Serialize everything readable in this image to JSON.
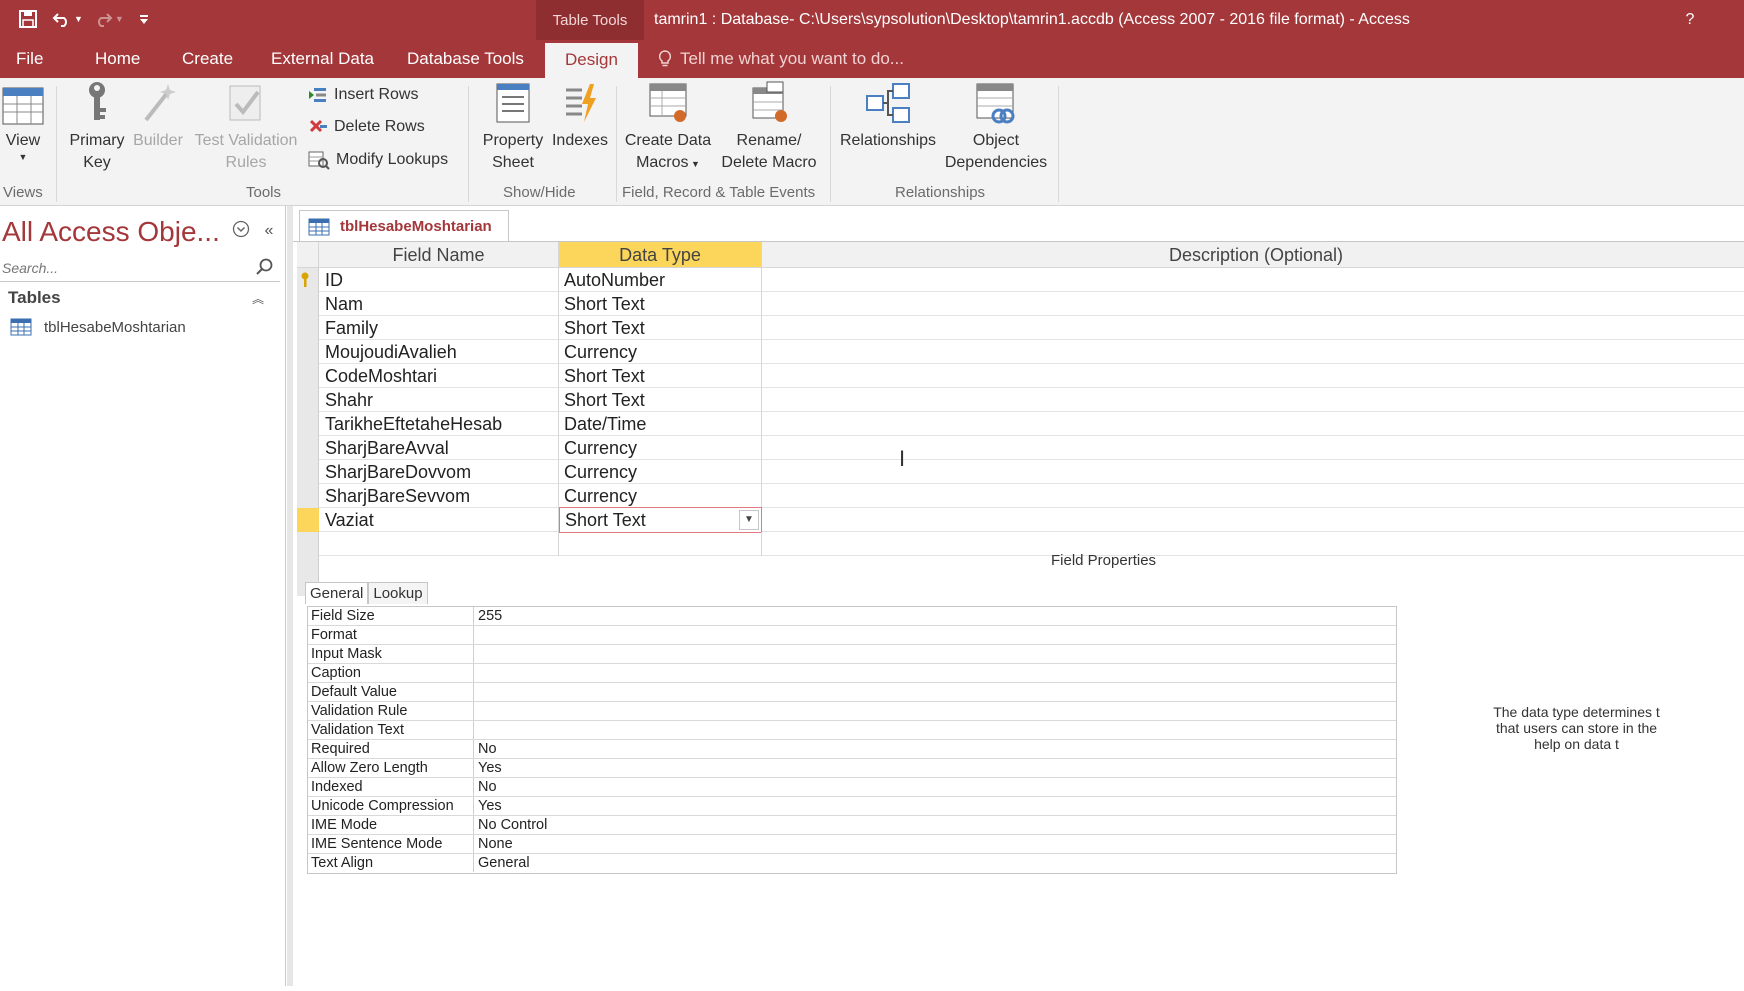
{
  "titlebar": {
    "context_tab": "Table Tools",
    "title": "tamrin1 : Database- C:\\Users\\sypsolution\\Desktop\\tamrin1.accdb (Access 2007 - 2016 file format) - Access",
    "help": "?"
  },
  "tabs": {
    "file": "File",
    "home": "Home",
    "create": "Create",
    "external_data": "External Data",
    "database_tools": "Database Tools",
    "design": "Design",
    "tell_me": "Tell me what you want to do..."
  },
  "ribbon": {
    "view": "View",
    "primary_key_1": "Primary",
    "primary_key_2": "Key",
    "builder": "Builder",
    "test_validation_1": "Test Validation",
    "test_validation_2": "Rules",
    "insert_rows": "Insert Rows",
    "delete_rows": "Delete Rows",
    "modify_lookups": "Modify Lookups",
    "property_sheet_1": "Property",
    "property_sheet_2": "Sheet",
    "indexes": "Indexes",
    "create_data_macros_1": "Create Data",
    "create_data_macros_2": "Macros",
    "rename_macro_1": "Rename/",
    "rename_macro_2": "Delete Macro",
    "relationships": "Relationships",
    "object_dependencies_1": "Object",
    "object_dependencies_2": "Dependencies",
    "groups": {
      "views": "Views",
      "tools": "Tools",
      "show_hide": "Show/Hide",
      "events": "Field, Record & Table Events",
      "relationships": "Relationships"
    }
  },
  "nav": {
    "title": "All Access Obje...",
    "search_placeholder": "Search...",
    "group": "Tables",
    "item": "tblHesabeMoshtarian"
  },
  "doc": {
    "tab": "tblHesabeMoshtarian",
    "headers": {
      "field_name": "Field Name",
      "data_type": "Data Type",
      "description": "Description (Optional)"
    },
    "rows": [
      {
        "field": "ID",
        "type": "AutoNumber"
      },
      {
        "field": "Nam",
        "type": "Short Text"
      },
      {
        "field": "Family",
        "type": "Short Text"
      },
      {
        "field": "MoujoudiAvalieh",
        "type": "Currency"
      },
      {
        "field": "CodeMoshtari",
        "type": "Short Text"
      },
      {
        "field": "Shahr",
        "type": "Short Text"
      },
      {
        "field": "TarikheEftetaheHesab",
        "type": "Date/Time"
      },
      {
        "field": "SharjBareAvval",
        "type": "Currency"
      },
      {
        "field": "SharjBareDovvom",
        "type": "Currency"
      },
      {
        "field": "SharjBareSevvom",
        "type": "Currency"
      },
      {
        "field": "Vaziat",
        "type": "Short Text"
      }
    ]
  },
  "field_properties": {
    "label": "Field Properties",
    "tab_general": "General",
    "tab_lookup": "Lookup",
    "rows": [
      {
        "k": "Field Size",
        "v": "255"
      },
      {
        "k": "Format",
        "v": ""
      },
      {
        "k": "Input Mask",
        "v": ""
      },
      {
        "k": "Caption",
        "v": ""
      },
      {
        "k": "Default Value",
        "v": ""
      },
      {
        "k": "Validation Rule",
        "v": ""
      },
      {
        "k": "Validation Text",
        "v": ""
      },
      {
        "k": "Required",
        "v": "No"
      },
      {
        "k": "Allow Zero Length",
        "v": "Yes"
      },
      {
        "k": "Indexed",
        "v": "No"
      },
      {
        "k": "Unicode Compression",
        "v": "Yes"
      },
      {
        "k": "IME Mode",
        "v": "No Control"
      },
      {
        "k": "IME Sentence Mode",
        "v": "None"
      },
      {
        "k": "Text Align",
        "v": "General"
      }
    ],
    "help_1": "The data type determines t",
    "help_2": "that users can store in the",
    "help_3": "help on data t"
  },
  "colors": {
    "accent": "#a4373a",
    "selected_header": "#fbd65a"
  }
}
